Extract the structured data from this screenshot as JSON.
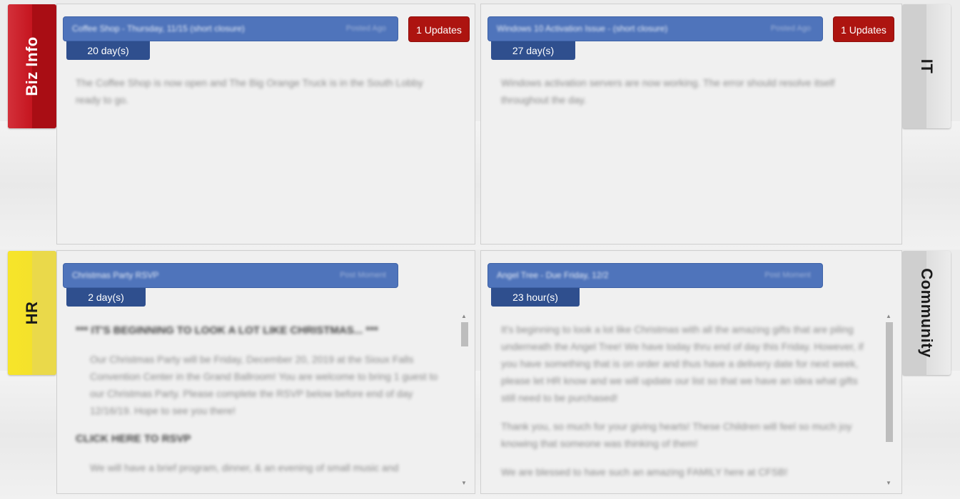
{
  "colors": {
    "biz_info": "#c0141c",
    "hr": "#f2da2b",
    "it": "#d6d6d6",
    "community": "#d6d6d6",
    "title_bar": "#4f74bb",
    "age_badge": "#2f4f8e",
    "updates_button": "#ad1410"
  },
  "sections": {
    "biz_info": "Biz Info",
    "it": "IT",
    "hr": "HR",
    "community": "Community"
  },
  "posts": {
    "biz": {
      "title": "Coffee Shop - Thursday, 11/15 (short closure)",
      "meta": "Posted Ago",
      "age": "20 day(s)",
      "updates": "1 Updates",
      "body": "The Coffee Shop is now open and The Big Orange Truck is in the South Lobby ready to go."
    },
    "it": {
      "title": "Windows 10 Activation Issue - (short closure)",
      "meta": "Posted Ago",
      "age": "27 day(s)",
      "updates": "1 Updates",
      "body": "Windows activation servers are now working. The error should resolve itself throughout the day."
    },
    "hr": {
      "title": "Christmas Party RSVP",
      "meta": "Post Moment",
      "age": "2 day(s)",
      "heading": "*** IT'S BEGINNING TO LOOK A LOT LIKE CHRISTMAS... ***",
      "paragraph": "Our Christmas Party will be Friday, December 20, 2019 at the Sioux Falls Convention Center in the Grand Ballroom! You are welcome to bring 1 guest to our Christmas Party. Please complete the RSVP below before end of day 12/16/19. Hope to see you there!",
      "link": "CLICK HERE TO RSVP",
      "paragraph2": "We will have a brief program, dinner, & an evening of small music and"
    },
    "community": {
      "title": "Angel Tree - Due Friday, 12/2",
      "meta": "Post Moment",
      "age": "23 hour(s)",
      "paragraph1": "It's beginning to look a lot like Christmas with all the amazing gifts that are piling underneath the Angel Tree! We have today thru end of day this Friday. However, if you have something that is on order and thus have a delivery date for next week, please let HR know and we will update our list so that we have an idea what gifts still need to be purchased!",
      "paragraph2": "Thank you, so much for your giving hearts! These Children will feel so much joy knowing that someone was thinking of them!",
      "paragraph3": "We are blessed to have such an amazing FAMILY here at CFSB!"
    }
  }
}
